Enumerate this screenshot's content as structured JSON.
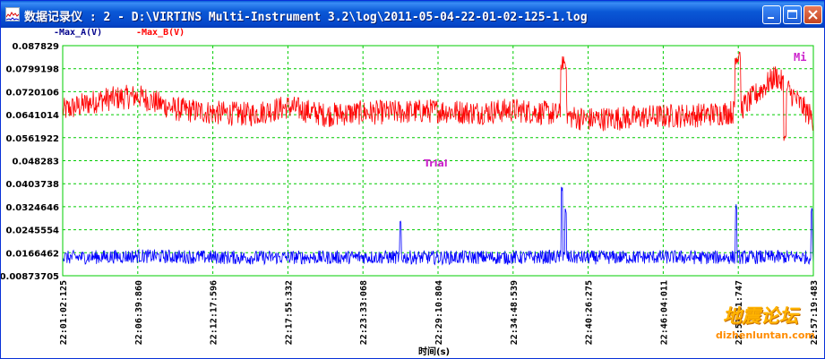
{
  "window": {
    "title": "数据记录仪 : 2 - D:\\VIRTINS Multi-Instrument 3.2\\log\\2011-05-04-22-01-02-125-1.log"
  },
  "legend": {
    "series_a": "-Max_A(V)",
    "series_b": "-Max_B(V)"
  },
  "annotations": {
    "trial": "Trial",
    "mi": "Mi"
  },
  "watermark": {
    "cn": "地震论坛",
    "url": "dizhenluntan.com"
  },
  "colors": {
    "series_a": "#0000ff",
    "series_b": "#ff0000",
    "grid": "#00cc00",
    "annotation": "#cc22cc"
  },
  "chart_data": {
    "type": "line",
    "xlabel": "时间(s)",
    "ylabel": "",
    "ylim": [
      0.00873705,
      0.087829
    ],
    "grid": true,
    "y_ticks": [
      "0.087829",
      "0.0799198",
      "0.0720106",
      "0.0641014",
      "0.0561922",
      "0.048283",
      "0.0403738",
      "0.0324646",
      "0.0245554",
      "0.0166462",
      "0.00873705"
    ],
    "x_ticks": [
      "22:01:02:125",
      "22:06:39:860",
      "22:12:17:596",
      "22:17:55:332",
      "22:23:33:068",
      "22:29:10:804",
      "22:34:48:539",
      "22:40:26:275",
      "22:46:04:011",
      "22:51:41:747",
      "22:57:19:483"
    ],
    "series": [
      {
        "name": "-Max_B(V)",
        "x": [
          "22:01:02:125",
          "22:03:50:992",
          "22:06:39:860",
          "22:09:28:728",
          "22:12:17:596",
          "22:15:06:464",
          "22:17:55:332",
          "22:20:44:200",
          "22:23:33:068",
          "22:26:21:936",
          "22:29:10:804",
          "22:31:59:672",
          "22:34:48:539",
          "22:37:37:407",
          "22:40:26:275",
          "22:43:15:143",
          "22:46:04:011",
          "22:48:52:879",
          "22:51:41:747",
          "22:54:30:615",
          "22:57:19:483"
        ],
        "values": [
          0.0655,
          0.0692,
          0.0705,
          0.066,
          0.0648,
          0.0642,
          0.0668,
          0.064,
          0.0648,
          0.065,
          0.0655,
          0.0648,
          0.0657,
          0.0645,
          0.0625,
          0.063,
          0.0636,
          0.064,
          0.0652,
          0.0775,
          0.0625
        ],
        "peak": 0.087829,
        "min": 0.0512
      },
      {
        "name": "-Max_A(V)",
        "x": [
          "22:01:02:125",
          "22:03:50:992",
          "22:06:39:860",
          "22:09:28:728",
          "22:12:17:596",
          "22:15:06:464",
          "22:17:55:332",
          "22:20:44:200",
          "22:23:33:068",
          "22:26:21:936",
          "22:29:10:804",
          "22:31:59:672",
          "22:34:48:539",
          "22:37:37:407",
          "22:40:26:275",
          "22:43:15:143",
          "22:46:04:011",
          "22:48:52:879",
          "22:51:41:747",
          "22:54:30:615",
          "22:57:19:483"
        ],
        "values": [
          0.015,
          0.0152,
          0.0155,
          0.0153,
          0.0151,
          0.015,
          0.0151,
          0.015,
          0.0152,
          0.0151,
          0.015,
          0.0151,
          0.015,
          0.0152,
          0.015,
          0.0151,
          0.0152,
          0.015,
          0.0151,
          0.0152,
          0.0151
        ],
        "peak": 0.0421
      }
    ]
  }
}
